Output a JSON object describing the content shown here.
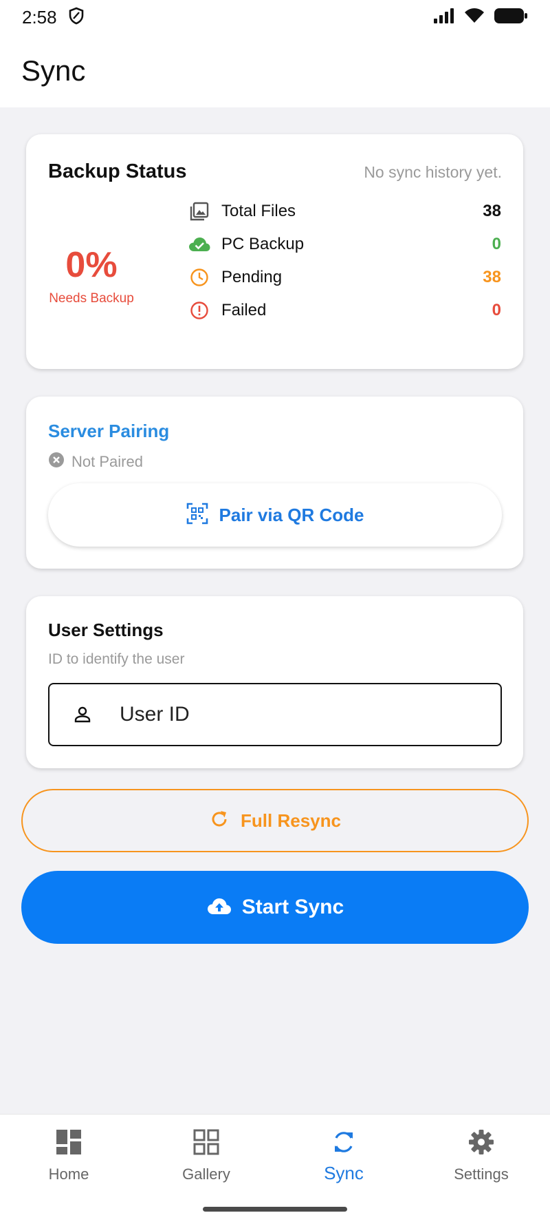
{
  "status_bar": {
    "time": "2:58"
  },
  "app_bar": {
    "title": "Sync"
  },
  "backup_status": {
    "title": "Backup Status",
    "history": "No sync history yet.",
    "percent": "0%",
    "percent_label": "Needs Backup",
    "stats": [
      {
        "label": "Total Files",
        "value": "38",
        "icon": "photo-library-icon",
        "color": "#111111"
      },
      {
        "label": "PC Backup",
        "value": "0",
        "icon": "cloud-done-icon",
        "color": "#4caf50"
      },
      {
        "label": "Pending",
        "value": "38",
        "icon": "clock-icon",
        "color": "#f7941d"
      },
      {
        "label": "Failed",
        "value": "0",
        "icon": "error-icon",
        "color": "#e74c3c"
      }
    ]
  },
  "server_pairing": {
    "title": "Server Pairing",
    "status": "Not Paired",
    "button_label": "Pair via QR Code"
  },
  "user_settings": {
    "title": "User Settings",
    "subtitle": "ID to identify the user",
    "field_placeholder": "User ID",
    "field_value": ""
  },
  "actions": {
    "resync_label": "Full Resync",
    "sync_label": "Start Sync"
  },
  "nav": {
    "items": [
      {
        "label": "Home",
        "icon": "dashboard-icon",
        "active": false
      },
      {
        "label": "Gallery",
        "icon": "grid-icon",
        "active": false
      },
      {
        "label": "Sync",
        "icon": "sync-icon",
        "active": true
      },
      {
        "label": "Settings",
        "icon": "gear-icon",
        "active": false
      }
    ]
  },
  "colors": {
    "accent": "#1f7ae0",
    "primary_button": "#0a7cf5",
    "warning": "#f7941d",
    "error": "#e74c3c",
    "success": "#4caf50"
  }
}
